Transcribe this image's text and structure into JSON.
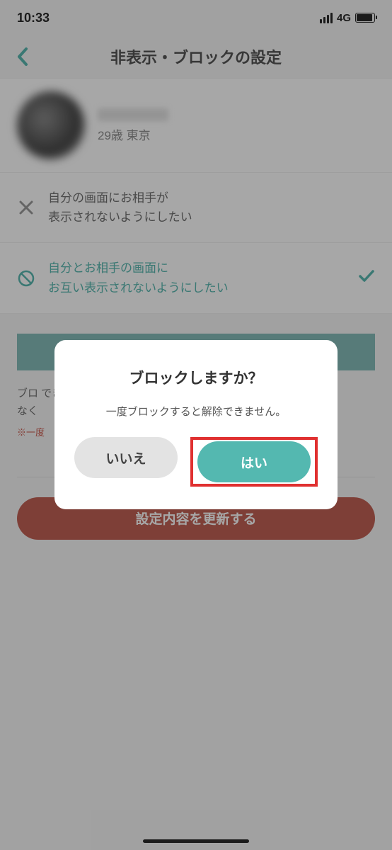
{
  "status": {
    "time": "10:33",
    "network": "4G"
  },
  "nav": {
    "title": "非表示・ブロックの設定"
  },
  "profile": {
    "meta": "29歳 東京"
  },
  "options": {
    "hide": "自分の画面にお相手が\n表示されないようにしたい",
    "block": "自分とお相手の画面に\nお互い表示されないようにしたい"
  },
  "lower": {
    "desc": "ブロ                                                                                でき\nなく",
    "note": "※一度"
  },
  "update": {
    "label": "設定内容を更新する"
  },
  "modal": {
    "title": "ブロックしますか？",
    "message": "一度ブロックすると解除できません。",
    "no": "いいえ",
    "yes": "はい"
  }
}
